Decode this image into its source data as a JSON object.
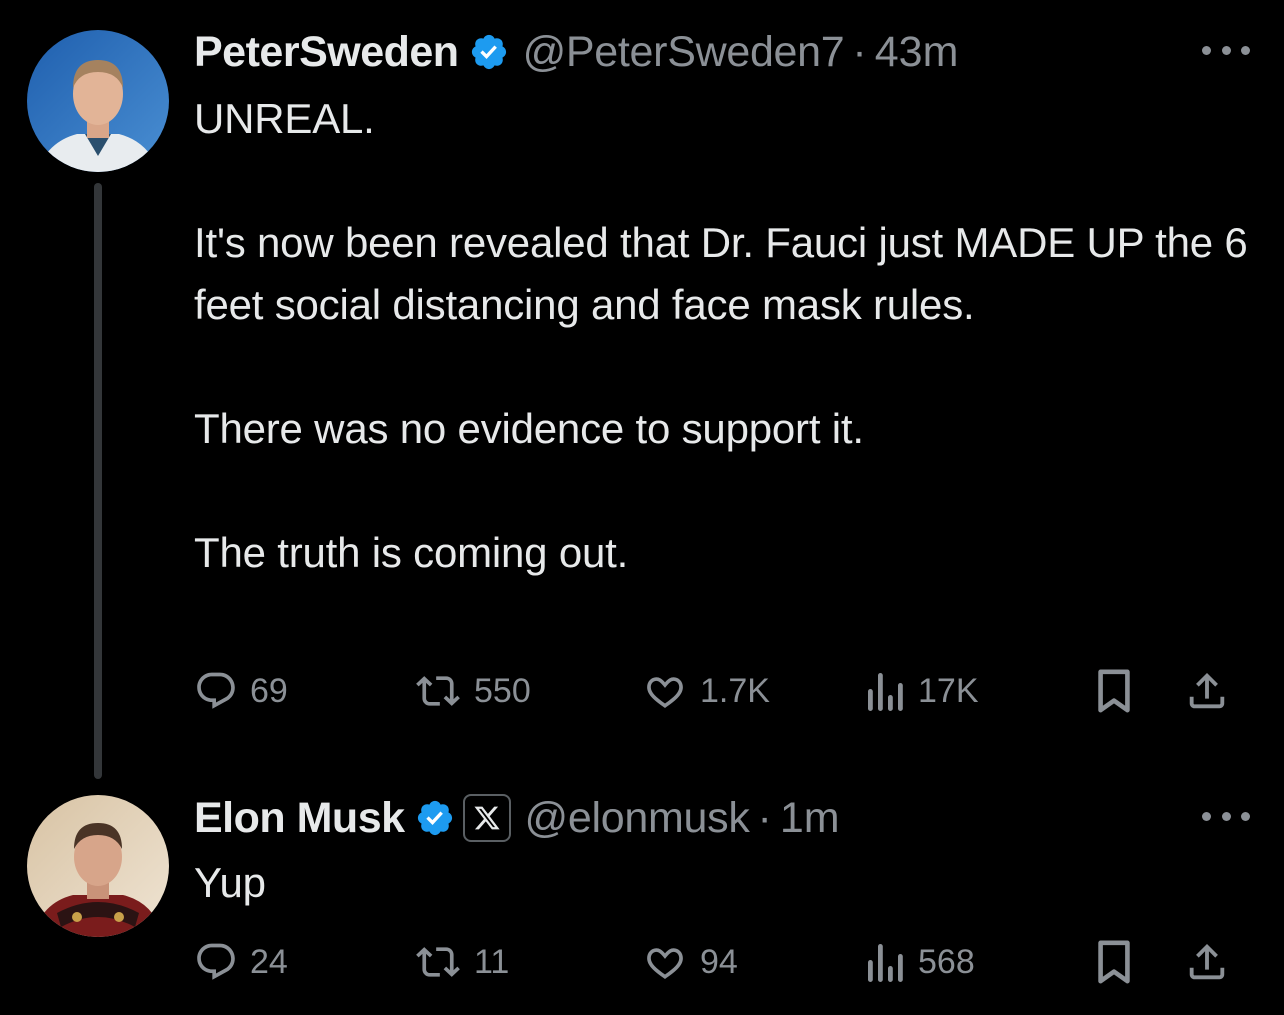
{
  "colors": {
    "background": "#000000",
    "text_primary": "#e7e9ea",
    "text_secondary": "#8b9096",
    "verified_blue": "#1d9bf0",
    "thread_line": "#333639"
  },
  "tweets": [
    {
      "author": {
        "name": "PeterSweden",
        "handle": "@PeterSweden7",
        "verified": true,
        "avatar": "avatar-photo-man-blue-background"
      },
      "time": "43m",
      "separator": "·",
      "text": "UNREAL.\n\nIt's now been revealed that Dr. Fauci just MADE UP the 6 feet social distancing and face mask rules.\n\nThere was no evidence to support it.\n\nThe truth is coming out.",
      "stats": {
        "replies": "69",
        "reposts": "550",
        "likes": "1.7K",
        "views": "17K"
      },
      "icons": [
        "reply-icon",
        "repost-icon",
        "like-icon",
        "views-icon",
        "bookmark-icon",
        "share-icon",
        "more-icon",
        "verified-badge-icon"
      ]
    },
    {
      "author": {
        "name": "Elon Musk",
        "handle": "@elonmusk",
        "verified": true,
        "affiliate": "𝕏",
        "avatar": "avatar-photo-man-red-armor"
      },
      "time": "1m",
      "separator": "·",
      "text": "Yup",
      "stats": {
        "replies": "24",
        "reposts": "11",
        "likes": "94",
        "views": "568"
      },
      "icons": [
        "reply-icon",
        "repost-icon",
        "like-icon",
        "views-icon",
        "bookmark-icon",
        "share-icon",
        "more-icon",
        "verified-badge-icon",
        "x-affiliate-icon"
      ]
    }
  ]
}
